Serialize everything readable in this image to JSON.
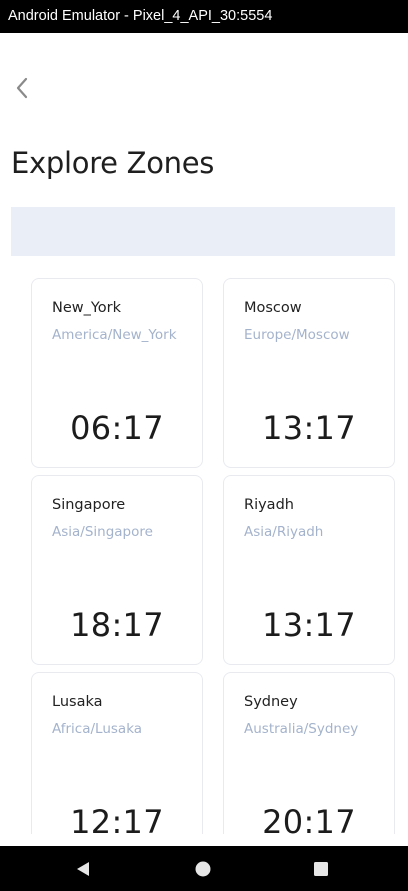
{
  "window": {
    "title": "Android Emulator - Pixel_4_API_30:5554"
  },
  "header": {
    "back_icon": "chevron-left-icon",
    "title": "Explore Zones"
  },
  "search": {
    "value": "",
    "placeholder": ""
  },
  "zones": [
    {
      "name": "New_York",
      "timezone": "America/New_York",
      "time": "06:17"
    },
    {
      "name": "Moscow",
      "timezone": "Europe/Moscow",
      "time": "13:17"
    },
    {
      "name": "Singapore",
      "timezone": "Asia/Singapore",
      "time": "18:17"
    },
    {
      "name": "Riyadh",
      "timezone": "Asia/Riyadh",
      "time": "13:17"
    },
    {
      "name": "Lusaka",
      "timezone": "Africa/Lusaka",
      "time": "12:17"
    },
    {
      "name": "Sydney",
      "timezone": "Australia/Sydney",
      "time": "20:17"
    }
  ],
  "nav": {
    "back_icon": "triangle-back-icon",
    "home_icon": "circle-home-icon",
    "recents_icon": "square-recents-icon"
  },
  "colors": {
    "search_bg": "#e9eef7",
    "timezone_text": "#a4b3cc",
    "card_border": "#e8eaef"
  }
}
